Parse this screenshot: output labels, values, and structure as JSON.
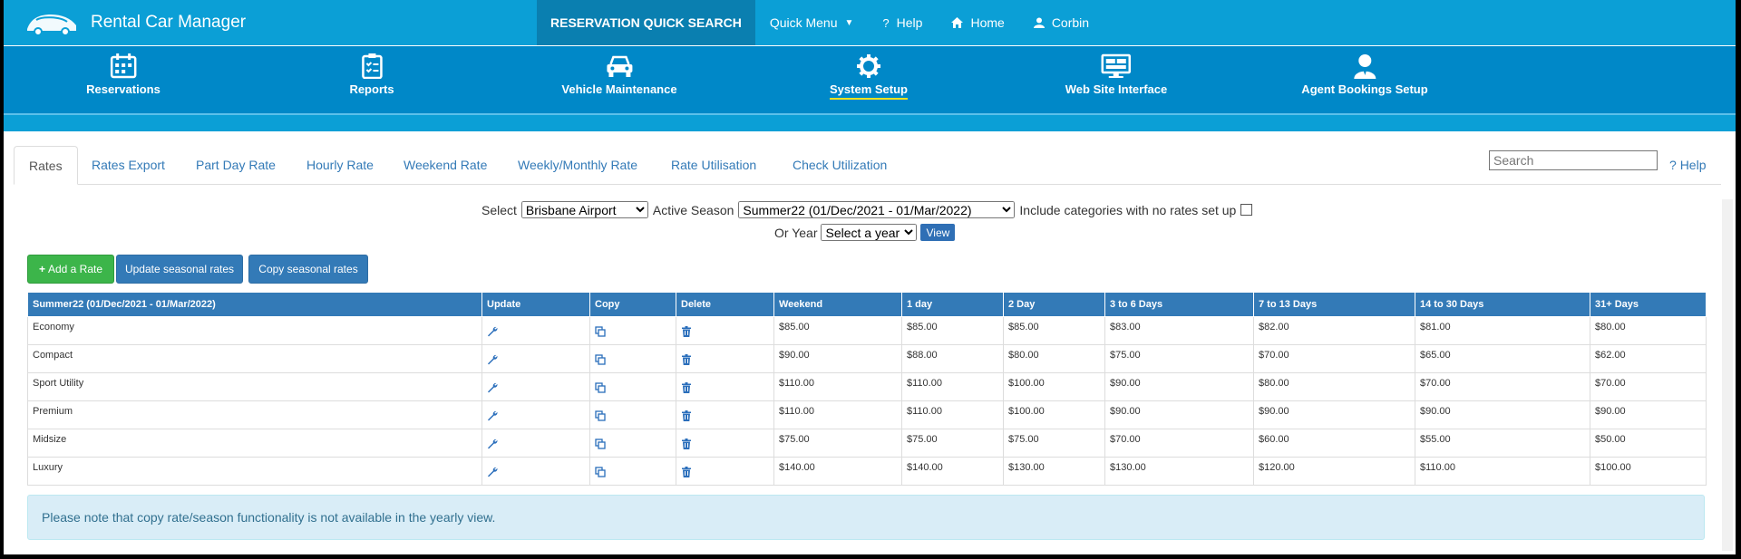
{
  "app": {
    "title": "Rental Car Manager"
  },
  "topnav": {
    "quick_search": "RESERVATION QUICK SEARCH",
    "quick_menu": "Quick Menu",
    "help": "Help",
    "home": "Home",
    "user": "Corbin"
  },
  "modules": {
    "reservations": "Reservations",
    "reports": "Reports",
    "vehicle_maintenance": "Vehicle Maintenance",
    "system_setup": "System Setup",
    "web_site_interface": "Web Site Interface",
    "agent_bookings_setup": "Agent Bookings Setup"
  },
  "tabs": {
    "rates": "Rates",
    "rates_export": "Rates Export",
    "part_day_rate": "Part Day Rate",
    "hourly_rate": "Hourly Rate",
    "weekend_rate": "Weekend Rate",
    "weekly_monthly_rate": "Weekly/Monthly Rate",
    "rate_utilisation": "Rate Utilisation",
    "check_utilization": "Check Utilization"
  },
  "search": {
    "placeholder": "Search"
  },
  "help_link": "Help",
  "filters": {
    "select_label": "Select",
    "location": "Brisbane Airport",
    "active_season_label": "Active Season",
    "season": "Summer22 (01/Dec/2021 - 01/Mar/2022)",
    "include_label": "Include categories with no rates set up",
    "or_year_label": "Or Year",
    "year_placeholder": "Select a year",
    "view_button": "View"
  },
  "buttons": {
    "add_rate": "Add a Rate",
    "update_seasonal": "Update seasonal rates",
    "copy_seasonal": "Copy seasonal rates"
  },
  "table": {
    "headers": {
      "season": "Summer22 (01/Dec/2021 - 01/Mar/2022)",
      "update": "Update",
      "copy": "Copy",
      "delete": "Delete",
      "weekend": "Weekend",
      "day1": "1 day",
      "day2": "2 Day",
      "d3_6": "3 to 6 Days",
      "d7_13": "7 to 13 Days",
      "d14_30": "14 to 30 Days",
      "d31": "31+ Days"
    },
    "rows": [
      {
        "category": "Economy",
        "weekend": "$85.00",
        "day1": "$85.00",
        "day2": "$85.00",
        "d3_6": "$83.00",
        "d7_13": "$82.00",
        "d14_30": "$81.00",
        "d31": "$80.00"
      },
      {
        "category": "Compact",
        "weekend": "$90.00",
        "day1": "$88.00",
        "day2": "$80.00",
        "d3_6": "$75.00",
        "d7_13": "$70.00",
        "d14_30": "$65.00",
        "d31": "$62.00"
      },
      {
        "category": "Sport Utility",
        "weekend": "$110.00",
        "day1": "$110.00",
        "day2": "$100.00",
        "d3_6": "$90.00",
        "d7_13": "$80.00",
        "d14_30": "$70.00",
        "d31": "$70.00"
      },
      {
        "category": "Premium",
        "weekend": "$110.00",
        "day1": "$110.00",
        "day2": "$100.00",
        "d3_6": "$90.00",
        "d7_13": "$90.00",
        "d14_30": "$90.00",
        "d31": "$90.00"
      },
      {
        "category": "Midsize",
        "weekend": "$75.00",
        "day1": "$75.00",
        "day2": "$75.00",
        "d3_6": "$70.00",
        "d7_13": "$60.00",
        "d14_30": "$55.00",
        "d31": "$50.00"
      },
      {
        "category": "Luxury",
        "weekend": "$140.00",
        "day1": "$140.00",
        "day2": "$130.00",
        "d3_6": "$130.00",
        "d7_13": "$120.00",
        "d14_30": "$110.00",
        "d31": "$100.00"
      }
    ]
  },
  "note": "Please note that copy rate/season functionality is not available in the yearly view.",
  "colors": {
    "topbar": "#0b9fd6",
    "modnav": "#0088c8",
    "table_header": "#337ab7",
    "add_button": "#3cb54a",
    "active_underline": "#f0e020"
  }
}
